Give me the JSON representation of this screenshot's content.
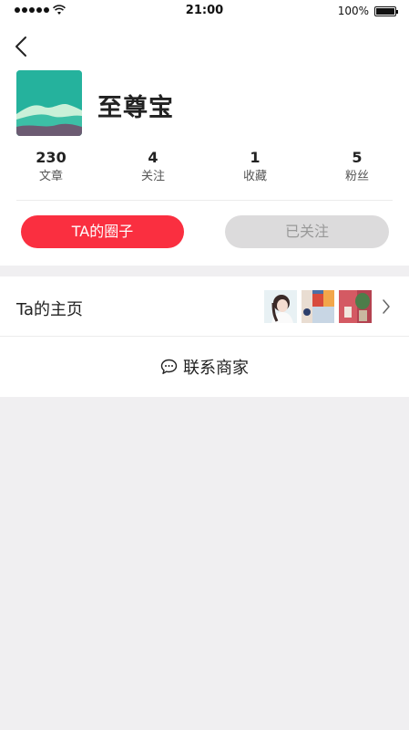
{
  "status_bar": {
    "time": "21:00",
    "battery": "100%"
  },
  "shop": {
    "name": "至尊宝"
  },
  "stats": [
    {
      "value": "230",
      "label": "文章"
    },
    {
      "value": "4",
      "label": "关注"
    },
    {
      "value": "1",
      "label": "收藏"
    },
    {
      "value": "5",
      "label": "粉丝"
    }
  ],
  "actions": {
    "circle_label": "TA的圈子",
    "followed_label": "已关注"
  },
  "home_row": {
    "label": "Ta的主页"
  },
  "contact": {
    "label": "联系商家"
  },
  "colors": {
    "accent": "#fa2f40",
    "followed_bg": "#dcdbdc",
    "avatar_bg": "#2cbba3"
  },
  "icons": [
    "back-icon",
    "wifi-icon",
    "battery-icon",
    "chevron-right-icon",
    "chat-bubble-icon"
  ]
}
